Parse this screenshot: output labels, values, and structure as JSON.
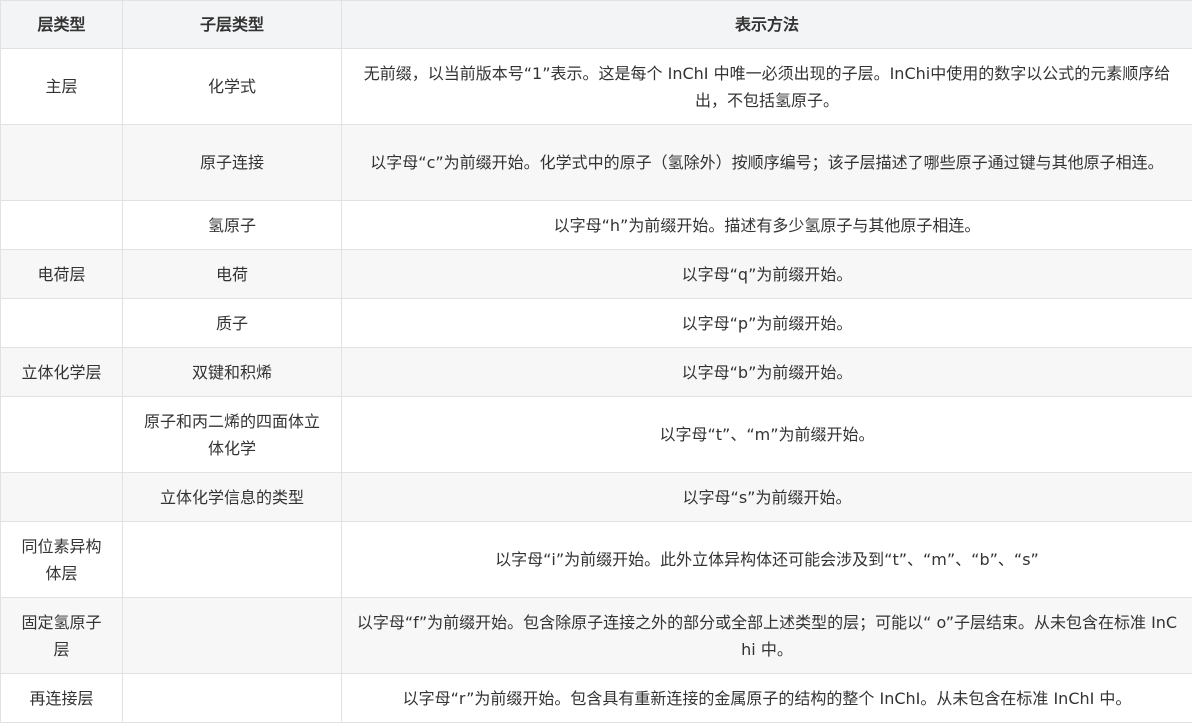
{
  "table": {
    "headers": [
      "层类型",
      "子层类型",
      "表示方法"
    ],
    "rows": [
      {
        "layer": "主层",
        "sublayer": "化学式",
        "method": "无前缀，以当前版本号“1”表示。这是每个 InChI 中唯一必须出现的子层。InChi中使用的数字以公式的元素顺序给出，不包括氢原子。"
      },
      {
        "layer": "",
        "sublayer": "原子连接",
        "method": "以字母“c”为前缀开始。化学式中的原子（氢除外）按顺序编号；该子层描述了哪些原子通过键与其他原子相连。"
      },
      {
        "layer": "",
        "sublayer": "氢原子",
        "method": "以字母“h”为前缀开始。描述有多少氢原子与其他原子相连。"
      },
      {
        "layer": "电荷层",
        "sublayer": "电荷",
        "method": "以字母“q”为前缀开始。"
      },
      {
        "layer": "",
        "sublayer": "质子",
        "method": "以字母“p”为前缀开始。"
      },
      {
        "layer": "立体化学层",
        "sublayer": "双键和积烯",
        "method": "以字母“b”为前缀开始。"
      },
      {
        "layer": "",
        "sublayer": "原子和丙二烯的四面体立体化学",
        "method": "以字母“t”、“m”为前缀开始。"
      },
      {
        "layer": "",
        "sublayer": "立体化学信息的类型",
        "method": "以字母“s”为前缀开始。"
      },
      {
        "layer": "同位素异构体层",
        "sublayer": "",
        "method": "以字母“i”为前缀开始。此外立体异构体还可能会涉及到“t”、“m”、“b”、“s”"
      },
      {
        "layer": "固定氢原子层",
        "sublayer": "",
        "method": "以字母“f”为前缀开始。包含除原子连接之外的部分或全部上述类型的层；可能以“ o”子层结束。从未包含在标准 InChi 中。"
      },
      {
        "layer": "再连接层",
        "sublayer": "",
        "method": "以字母“r”为前缀开始。包含具有重新连接的金属原子的结构的整个 InChI。从未包含在标准 InChI 中。"
      }
    ]
  }
}
